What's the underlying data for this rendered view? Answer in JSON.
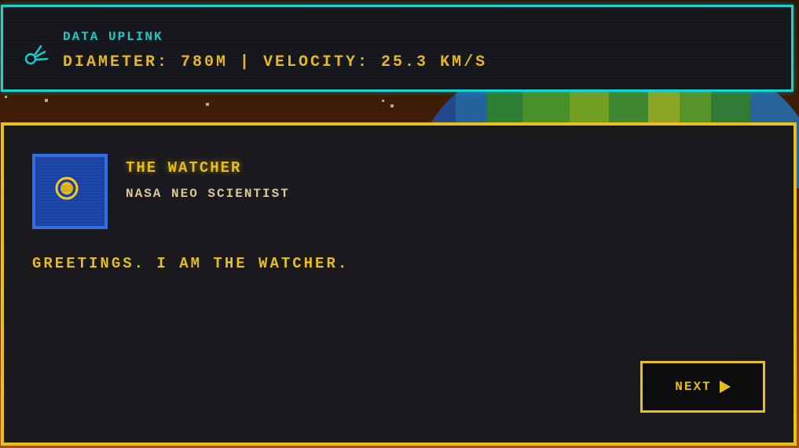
{
  "uplink": {
    "title": "DATA UPLINK",
    "stats": "DIAMETER: 780M | VELOCITY: 25.3 KM/S",
    "icon": "comet-icon",
    "accent_color": "#19d3d1"
  },
  "dialog": {
    "speaker_name": "THE WATCHER",
    "speaker_role": "NASA NEO SCIENTIST",
    "portrait_icon": "eye-icon",
    "message": "GREETINGS. I AM THE WATCHER.",
    "next_label": "NEXT",
    "next_icon": "play-arrow-icon",
    "accent_color": "#e6c11c"
  }
}
